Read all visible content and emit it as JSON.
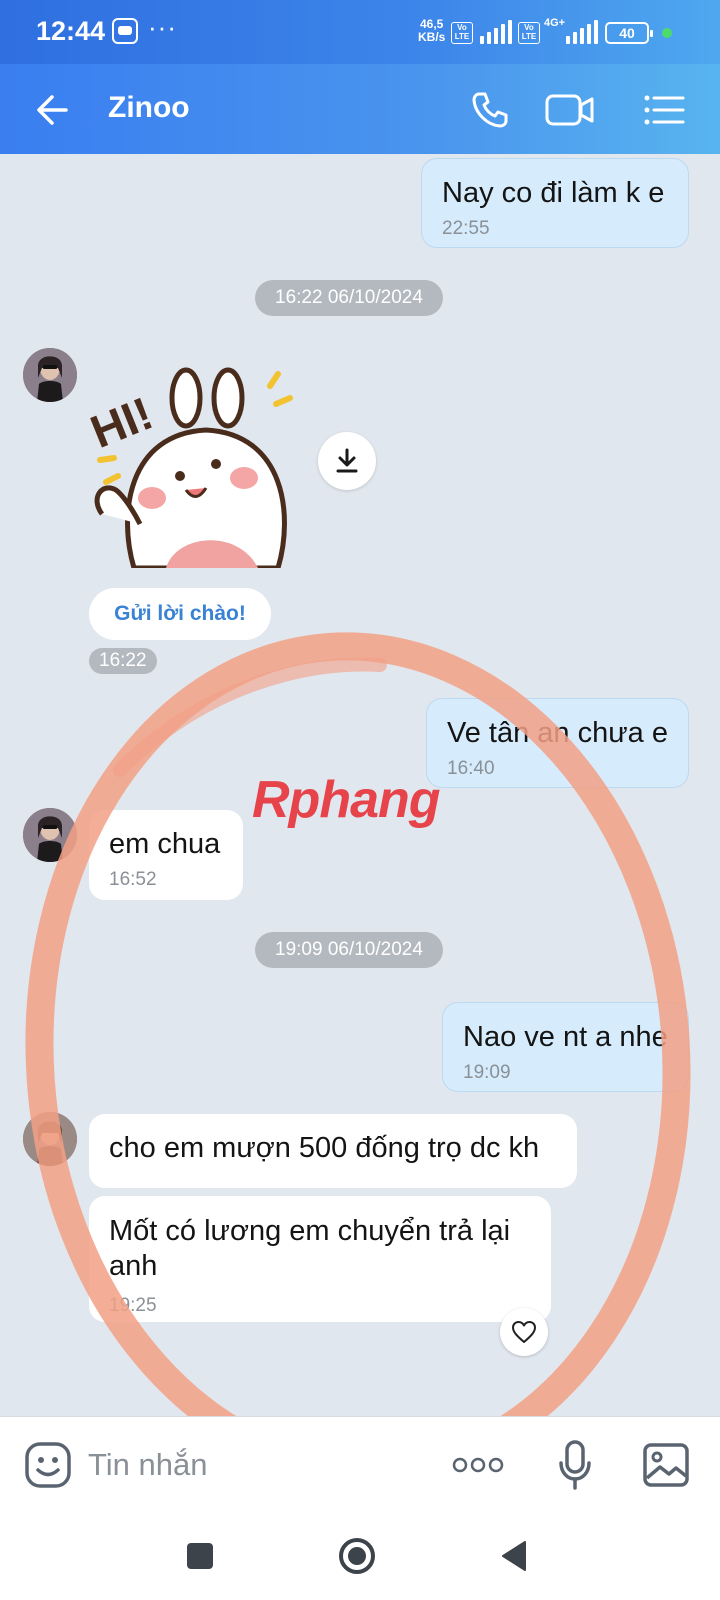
{
  "status_bar": {
    "time": "12:44",
    "more": "···",
    "net_speed_value": "46,5",
    "net_speed_unit": "KB/s",
    "volte_1": "Vo\nLTE",
    "volte_2": "Vo\nLTE",
    "network_type": "4G+",
    "battery": "40"
  },
  "header": {
    "title": "Zinoo",
    "icons": [
      "back-arrow-icon",
      "phone-icon",
      "video-call-icon",
      "menu-list-icon"
    ]
  },
  "messages": {
    "m1": {
      "text": "Nay co đi làm k e",
      "time": "22:55"
    },
    "date1": "16:22 06/10/2024",
    "sticker": {
      "greet_label": "Gửi lời chào!",
      "time": "16:22",
      "sticker_text": "HI!"
    },
    "m2": {
      "text": "Ve tân an chưa e",
      "time": "16:40"
    },
    "m3": {
      "text": "em chua",
      "time": "16:52"
    },
    "date2": "19:09 06/10/2024",
    "m4": {
      "text": "Nao ve nt a nhe",
      "time": "19:09"
    },
    "m5": {
      "text": "cho em mượn 500 đống trọ dc kh"
    },
    "m6": {
      "text": "Mốt có lương em chuyển trả lại anh",
      "time": "19:25"
    }
  },
  "watermark": "Rphang",
  "input": {
    "placeholder": "Tin nhắn"
  },
  "colors": {
    "header_start": "#3a7ef0",
    "header_end": "#58b4ef",
    "outgoing_bubble": "#d6ecfc",
    "incoming_bubble": "#ffffff",
    "chat_background": "#e1e7ee",
    "annotation_circle": "#f2a085"
  }
}
